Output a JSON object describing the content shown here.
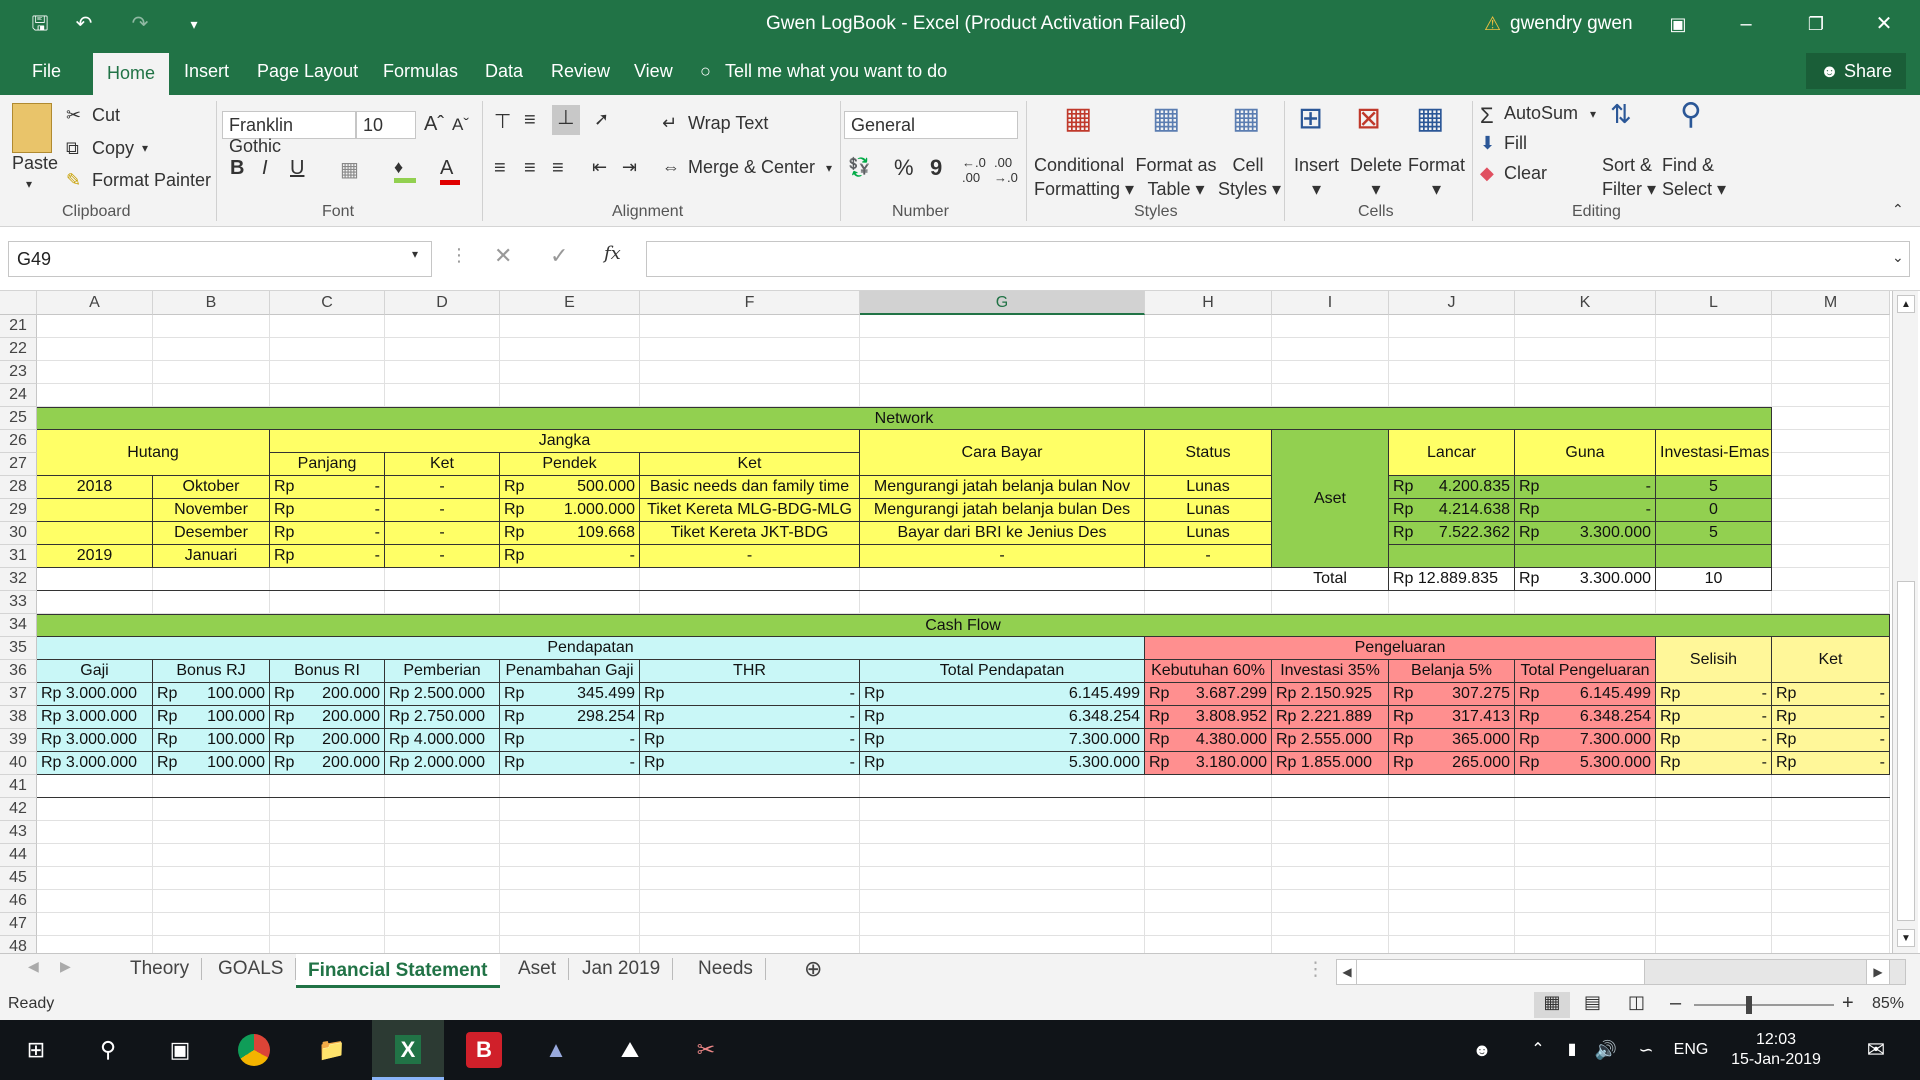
{
  "window": {
    "title": "Gwen LogBook - Excel (Product Activation Failed)",
    "user": "gwendry gwen"
  },
  "menu": {
    "file": "File",
    "tabs": [
      "Home",
      "Insert",
      "Page Layout",
      "Formulas",
      "Data",
      "Review",
      "View"
    ],
    "tell": "Tell me what you want to do",
    "share": "Share"
  },
  "ribbon": {
    "paste": "Paste",
    "cut": "Cut",
    "copy": "Copy",
    "format_painter": "Format Painter",
    "clipboard": "Clipboard",
    "font_name": "Franklin Gothic",
    "font_size": "10",
    "font": "Font",
    "bold": "B",
    "italic": "I",
    "underline": "U",
    "wrap": "Wrap Text",
    "merge": "Merge & Center",
    "alignment": "Alignment",
    "number_format": "General",
    "number": "Number",
    "percent": "%",
    "comma": "9",
    "cond1": "Conditional",
    "cond2": "Formatting",
    "fmt_table1": "Format as",
    "fmt_table2": "Table",
    "cell_styles1": "Cell",
    "cell_styles2": "Styles",
    "styles": "Styles",
    "insert": "Insert",
    "delete": "Delete",
    "format": "Format",
    "cells": "Cells",
    "autosum": "AutoSum",
    "fill": "Fill",
    "clear": "Clear",
    "sort1": "Sort &",
    "sort2": "Filter",
    "find1": "Find &",
    "find2": "Select",
    "editing": "Editing"
  },
  "formula_bar": {
    "name_box": "G49",
    "fx": "fx",
    "value": ""
  },
  "columns": [
    "A",
    "B",
    "C",
    "D",
    "E",
    "F",
    "G",
    "H",
    "I",
    "J",
    "K",
    "L",
    "M"
  ],
  "rows": [
    "21",
    "22",
    "23",
    "24",
    "25",
    "26",
    "27",
    "28",
    "29",
    "30",
    "31",
    "32",
    "33",
    "34",
    "35",
    "36",
    "37",
    "38",
    "39",
    "40",
    "41",
    "42",
    "43",
    "44",
    "45",
    "46",
    "47",
    "48"
  ],
  "network": {
    "title": "Network",
    "hutang": "Hutang",
    "jangka": "Jangka",
    "panjang": "Panjang",
    "ket": "Ket",
    "pendek": "Pendek",
    "ket2": "Ket",
    "cara_bayar": "Cara Bayar",
    "status": "Status",
    "aset": "Aset",
    "lancar": "Lancar",
    "guna": "Guna",
    "investasi_emas": "Investasi-Emas",
    "total": "Total",
    "rows": [
      {
        "year": "2018",
        "month": "Oktober",
        "panjang": "-",
        "ket": "-",
        "pendek": "500.000",
        "ket2": "Basic needs dan family time",
        "cara": "Mengurangi jatah belanja bulan Nov",
        "status": "Lunas",
        "lancar": "4.200.835",
        "guna": "-",
        "emas": "5"
      },
      {
        "year": "",
        "month": "November",
        "panjang": "-",
        "ket": "-",
        "pendek": "1.000.000",
        "ket2": "Tiket Kereta MLG-BDG-MLG",
        "cara": "Mengurangi jatah belanja bulan Des",
        "status": "Lunas",
        "lancar": "4.214.638",
        "guna": "-",
        "emas": "0"
      },
      {
        "year": "",
        "month": "Desember",
        "panjang": "-",
        "ket": "-",
        "pendek": "109.668",
        "ket2": "Tiket Kereta JKT-BDG",
        "cara": "Bayar dari BRI ke Jenius Des",
        "status": "Lunas",
        "lancar": "7.522.362",
        "guna": "3.300.000",
        "emas": "5"
      },
      {
        "year": "2019",
        "month": "Januari",
        "panjang": "-",
        "ket": "-",
        "pendek": "-",
        "ket2": "-",
        "cara": "-",
        "status": "-",
        "lancar": "",
        "guna": "",
        "emas": ""
      }
    ],
    "total_lancar": "Rp 12.889.835",
    "total_guna": "3.300.000",
    "total_emas": "10",
    "rp": "Rp"
  },
  "cashflow": {
    "title": "Cash Flow",
    "pendapatan": "Pendapatan",
    "pengeluaran": "Pengeluaran",
    "selisih": "Selisih",
    "ket": "Ket",
    "headers": [
      "Gaji",
      "Bonus RJ",
      "Bonus RI",
      "Pemberian",
      "Penambahan Gaji",
      "THR",
      "Total Pendapatan",
      "Kebutuhan 60%",
      "Investasi 35%",
      "Belanja 5%",
      "Total Pengeluaran"
    ],
    "rows": [
      [
        "Rp 3.000.000",
        "100.000",
        "200.000",
        "Rp 2.500.000",
        "345.499",
        "-",
        "6.145.499",
        "3.687.299",
        "Rp 2.150.925",
        "307.275",
        "6.145.499",
        "-",
        "-"
      ],
      [
        "Rp 3.000.000",
        "100.000",
        "200.000",
        "Rp 2.750.000",
        "298.254",
        "-",
        "6.348.254",
        "3.808.952",
        "Rp 2.221.889",
        "317.413",
        "6.348.254",
        "-",
        "-"
      ],
      [
        "Rp 3.000.000",
        "100.000",
        "200.000",
        "Rp 4.000.000",
        "-",
        "-",
        "7.300.000",
        "4.380.000",
        "Rp 2.555.000",
        "365.000",
        "7.300.000",
        "-",
        "-"
      ],
      [
        "Rp 3.000.000",
        "100.000",
        "200.000",
        "Rp 2.000.000",
        "-",
        "-",
        "5.300.000",
        "3.180.000",
        "Rp 1.855.000",
        "265.000",
        "5.300.000",
        "-",
        "-"
      ]
    ]
  },
  "sheets": [
    "Theory",
    "GOALS",
    "Financial Statement",
    "Aset",
    "Jan 2019",
    "Needs"
  ],
  "status": {
    "ready": "Ready",
    "zoom": "85%"
  },
  "taskbar": {
    "lang": "ENG",
    "time": "12:03",
    "date": "15-Jan-2019"
  }
}
